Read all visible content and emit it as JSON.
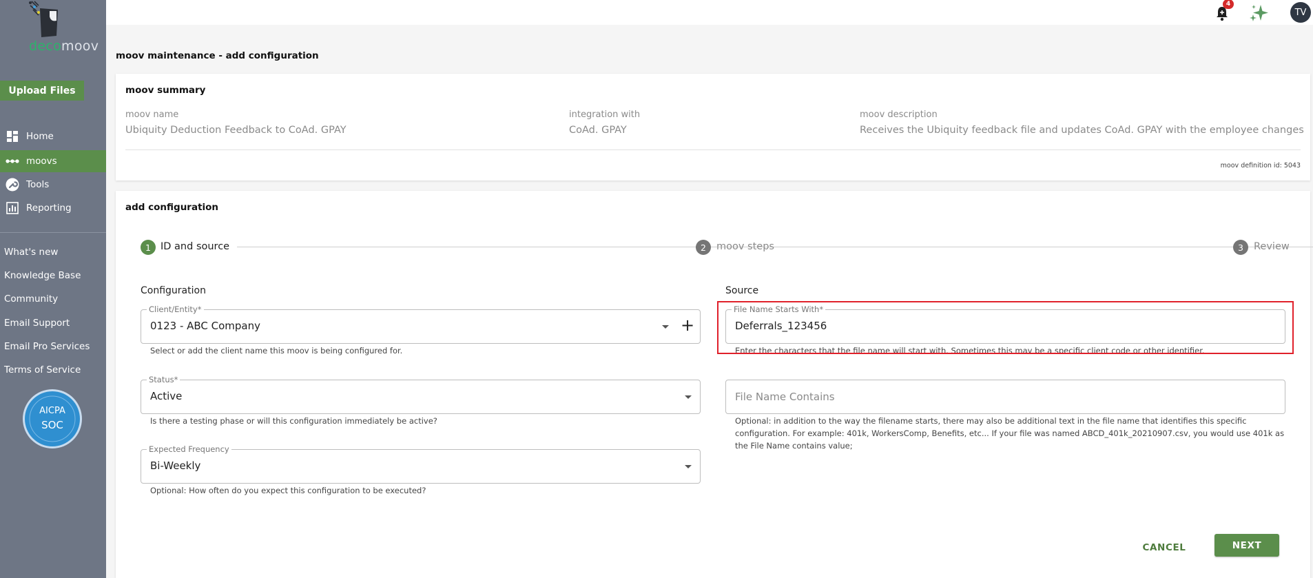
{
  "brand": {
    "part1": "deco",
    "part2": "moov"
  },
  "sidebar": {
    "upload_label": "Upload Files",
    "nav": [
      {
        "label": "Home",
        "icon": "dashboard-icon"
      },
      {
        "label": "moovs",
        "icon": "moovs-icon"
      },
      {
        "label": "Tools",
        "icon": "wrench-icon"
      },
      {
        "label": "Reporting",
        "icon": "chart-icon"
      }
    ],
    "links": [
      "What's new",
      "Knowledge Base",
      "Community",
      "Email Support",
      "Email Pro Services",
      "Terms of Service"
    ],
    "badge": {
      "line1": "AICPA",
      "line2": "SOC"
    }
  },
  "topbar": {
    "notification_count": "4",
    "avatar_initials": "TV"
  },
  "page_title": "moov maintenance - add configuration",
  "summary": {
    "title": "moov summary",
    "moov_name_label": "moov name",
    "moov_name": "Ubiquity Deduction Feedback to CoAd. GPAY",
    "integration_label": "integration with",
    "integration": "CoAd. GPAY",
    "description_label": "moov description",
    "description": "Receives the Ubiquity feedback file and updates CoAd. GPAY with the employee changes",
    "definition_id": "moov definition id: 5043"
  },
  "config": {
    "title": "add configuration",
    "steps": [
      {
        "num": "1",
        "label": "ID and source"
      },
      {
        "num": "2",
        "label": "moov steps"
      },
      {
        "num": "3",
        "label": "Review"
      }
    ],
    "configuration_label": "Configuration",
    "source_label": "Source",
    "client": {
      "legend": "Client/Entity*",
      "value": "0123 - ABC Company",
      "helper": "Select or add the client name this moov is being configured for."
    },
    "status": {
      "legend": "Status*",
      "value": "Active",
      "helper": "Is there a testing phase or will this configuration immediately be active?"
    },
    "frequency": {
      "legend": "Expected Frequency",
      "value": "Bi-Weekly",
      "helper": "Optional: How often do you expect this configuration to be executed?"
    },
    "file_starts": {
      "legend": "File Name Starts With*",
      "value": "Deferrals_123456",
      "helper": "Enter the characters that the file name will start with. Sometimes this may be a specific client code or other identifier."
    },
    "file_contains": {
      "placeholder": "File Name Contains",
      "helper_lines": [
        "Optional: in addition to the way the filename starts, there may also be additional text in the file name that identifies this specific",
        "configuration. For example: 401k, WorkersComp, Benefits, etc... If your file was named ABCD_401k_20210907.csv, you would use 401k as",
        "the File Name contains value;"
      ]
    },
    "cancel_label": "CANCEL",
    "next_label": "NEXT"
  },
  "colors": {
    "sidebar": "#6e7685",
    "accent_green": "#5b8e4b",
    "highlight_red": "#e0202a"
  }
}
